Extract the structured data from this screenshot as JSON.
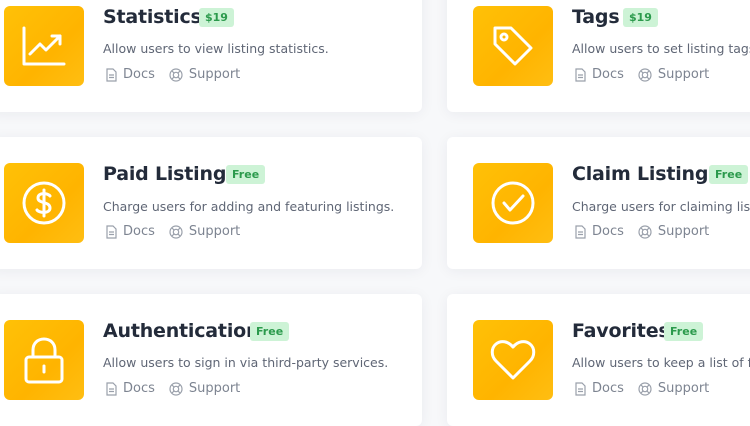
{
  "links": {
    "docs": "Docs",
    "support": "Support"
  },
  "colors": {
    "accent": "#ffb400",
    "badge_bg": "#cdf3d6",
    "badge_text": "#2b9a4c"
  },
  "addons": [
    {
      "title": "Statistics",
      "badge": "$19",
      "description": "Allow users to view listing statistics.",
      "icon": "chart-icon"
    },
    {
      "title": "Tags",
      "badge": "$19",
      "description": "Allow users to set listing tags.",
      "icon": "tag-icon"
    },
    {
      "title": "Paid Listings",
      "badge": "Free",
      "description": "Charge users for adding and featuring listings.",
      "icon": "dollar-icon"
    },
    {
      "title": "Claim Listings",
      "badge": "Free",
      "description": "Charge users for claiming listin",
      "icon": "checkmark-icon"
    },
    {
      "title": "Authentication",
      "badge": "Free",
      "description": "Allow users to sign in via third-party services.",
      "icon": "lock-icon"
    },
    {
      "title": "Favorites",
      "badge": "Free",
      "description": "Allow users to keep a list of fav",
      "icon": "heart-icon"
    }
  ]
}
